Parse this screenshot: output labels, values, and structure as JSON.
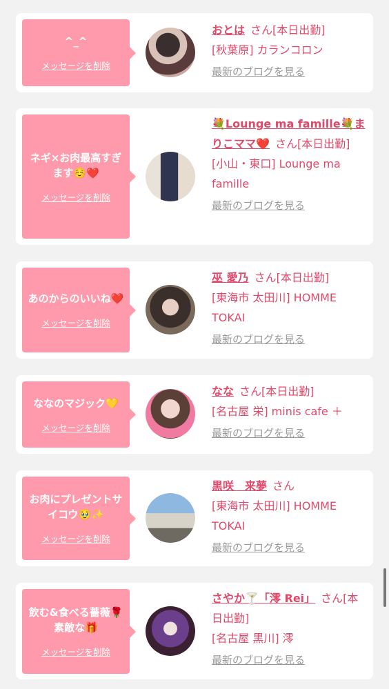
{
  "colors": {
    "accent": "#e0496a",
    "bubble": "#ff9aac",
    "muted": "#999999"
  },
  "cards": [
    {
      "message": "^_^",
      "delete_label": "メッセージを削除",
      "name": "おとは",
      "suffix": "さん[本日出勤]",
      "location": "[秋葉原] カランコロン",
      "blog_label": "最新のブログを見る"
    },
    {
      "message": "ネギ×お肉最高すぎます☺️❤️",
      "delete_label": "メッセージを削除",
      "name": "💐Lounge ma famille💐まりこママ❤️",
      "suffix": "さん[本日出勤]",
      "location": "[小山・東口] Lounge ma famille",
      "blog_label": "最新のブログを見る"
    },
    {
      "message": "あのからのいいね❤️",
      "delete_label": "メッセージを削除",
      "name": "巫 愛乃",
      "suffix": "さん[本日出勤]",
      "location": "[東海市 太田川] HOMME TOKAI",
      "blog_label": "最新のブログを見る"
    },
    {
      "message": "ななのマジック💛",
      "delete_label": "メッセージを削除",
      "name": "なな",
      "suffix": "さん[本日出勤]",
      "location": "[名古屋 栄] minis cafe ＋",
      "blog_label": "最新のブログを見る"
    },
    {
      "message": "お肉にプレゼントサイコウ🥹✨",
      "delete_label": "メッセージを削除",
      "name": "黒咲　来夢",
      "suffix": "さん",
      "location": "[東海市 太田川] HOMME TOKAI",
      "blog_label": "最新のブログを見る"
    },
    {
      "message": "飲む&食べる薔薇🌹素敵な🎁",
      "delete_label": "メッセージを削除",
      "name": "さやか🍸「澪 Rei」",
      "suffix": "さん[本日出勤]",
      "location": "[名古屋 黒川] 澪",
      "blog_label": "最新のブログを見る"
    }
  ]
}
